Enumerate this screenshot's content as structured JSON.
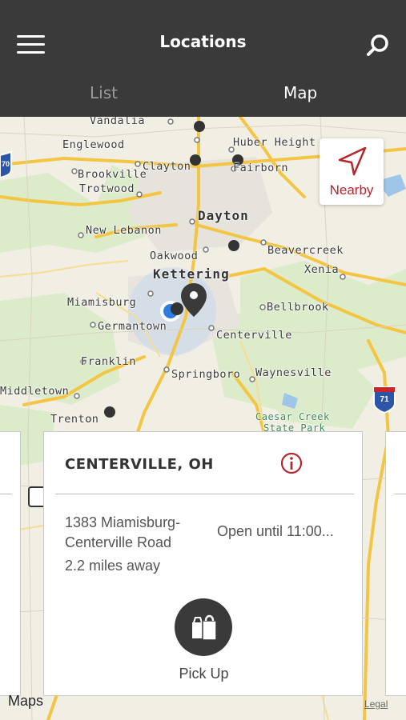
{
  "header": {
    "title": "Locations",
    "tabs": [
      {
        "label": "List",
        "active": false
      },
      {
        "label": "Map",
        "active": true
      }
    ]
  },
  "map": {
    "places": {
      "vandalia": "Vandalia",
      "englewood": "Englewood",
      "huber_heights": "Huber Height",
      "brookville": "Brookville",
      "clayton": "Clayton",
      "fairborn": "Fairborn",
      "trotwood": "Trotwood",
      "dayton": "Dayton",
      "new_lebanon": "New Lebanon",
      "beavercreek": "Beavercreek",
      "oakwood": "Oakwood",
      "xenia": "Xenia",
      "kettering": "Kettering",
      "miamisburg": "Miamisburg",
      "bellbrook": "Bellbrook",
      "germantown": "Germantown",
      "centerville": "Centerville",
      "franklin": "Franklin",
      "springboro": "Springboro",
      "waynesville": "Waynesville",
      "middletown": "Middletown",
      "trenton": "Trenton",
      "caesar_creek_1": "Caesar Creek",
      "caesar_creek_2": "State Park"
    },
    "shields": {
      "i70": "70",
      "i71": "71"
    },
    "nearby_label": "Nearby",
    "maps_logo": "Maps",
    "legal": "Legal"
  },
  "card": {
    "name": "CENTERVILLE, OH",
    "address": "1383 Miamisburg-Centerville Road",
    "hours": "Open until 11:00...",
    "distance": "2.2 miles away",
    "pickup_label": "Pick Up"
  },
  "colors": {
    "header_bg": "#3a3a3a",
    "accent": "#b5262d",
    "highway": "#f4c542",
    "map_bg": "#f1eee3",
    "green": "#d9ebcb"
  }
}
